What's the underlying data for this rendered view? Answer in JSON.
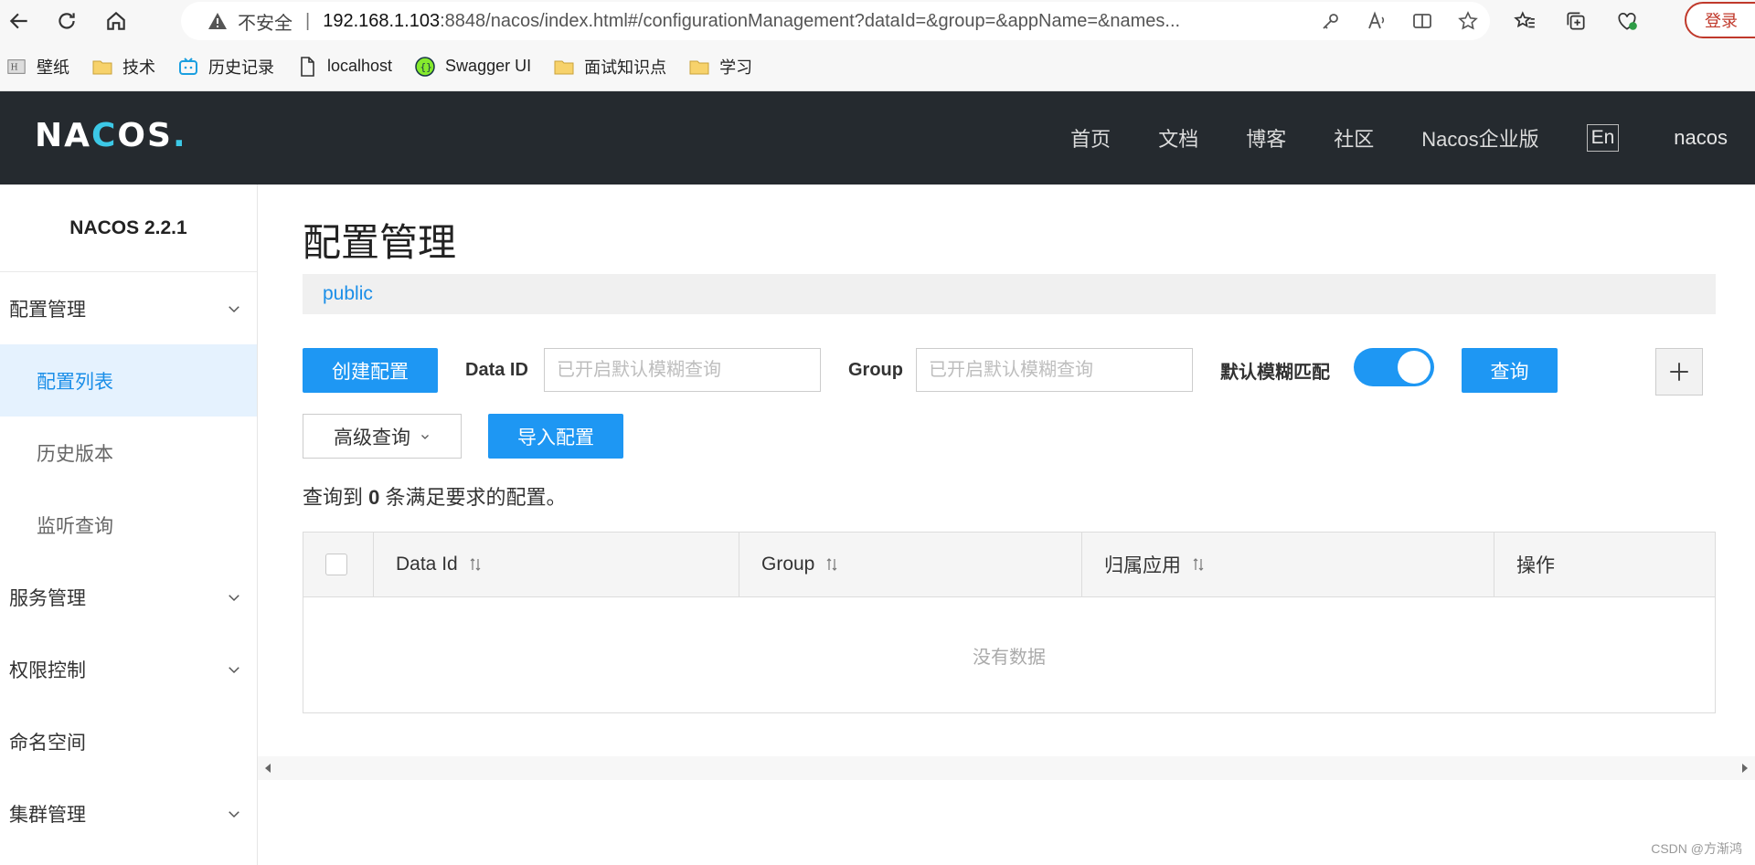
{
  "browser": {
    "insecure_label": "不安全",
    "url_host": "192.168.1.103",
    "url_rest": ":8848/nacos/index.html#/configurationManagement?dataId=&group=&appName=&names...",
    "login_label": "登录"
  },
  "bookmarks": [
    {
      "label": "壁纸",
      "icon": "wallpaper-icon"
    },
    {
      "label": "技术",
      "icon": "folder-icon"
    },
    {
      "label": "历史记录",
      "icon": "bilibili-icon"
    },
    {
      "label": "localhost",
      "icon": "page-icon"
    },
    {
      "label": "Swagger UI",
      "icon": "swagger-icon"
    },
    {
      "label": "面试知识点",
      "icon": "folder-icon"
    },
    {
      "label": "学习",
      "icon": "folder-icon"
    }
  ],
  "header": {
    "logo_text": "NACOS.",
    "nav": [
      "首页",
      "文档",
      "博客",
      "社区",
      "Nacos企业版"
    ],
    "lang": "En",
    "user": "nacos"
  },
  "sidebar": {
    "version": "NACOS 2.2.1",
    "items": [
      {
        "label": "配置管理",
        "type": "group"
      },
      {
        "label": "配置列表",
        "type": "sub",
        "active": true
      },
      {
        "label": "历史版本",
        "type": "sub"
      },
      {
        "label": "监听查询",
        "type": "sub"
      },
      {
        "label": "服务管理",
        "type": "group"
      },
      {
        "label": "权限控制",
        "type": "group"
      },
      {
        "label": "命名空间",
        "type": "plain"
      },
      {
        "label": "集群管理",
        "type": "group"
      }
    ]
  },
  "main": {
    "title": "配置管理",
    "namespace": "public",
    "create_label": "创建配置",
    "data_id_label": "Data ID",
    "data_id_placeholder": "已开启默认模糊查询",
    "group_label": "Group",
    "group_placeholder": "已开启默认模糊查询",
    "fuzzy_label": "默认模糊匹配",
    "fuzzy_on": true,
    "query_label": "查询",
    "advanced_label": "高级查询",
    "import_label": "导入配置",
    "result_prefix": "查询到",
    "result_count": "0",
    "result_suffix": "条满足要求的配置。",
    "table": {
      "columns": [
        "Data Id",
        "Group",
        "归属应用",
        "操作"
      ],
      "empty_text": "没有数据"
    }
  },
  "watermark": "CSDN @方渐鸿",
  "colors": {
    "primary": "#1e97f3",
    "header_bg": "#252a2f",
    "active_bg": "#e5f2fe"
  }
}
